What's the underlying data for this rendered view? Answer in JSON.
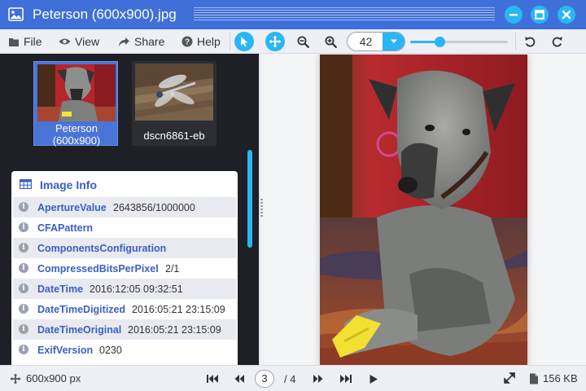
{
  "window": {
    "title": "Peterson (600x900).jpg"
  },
  "menu": {
    "file": "File",
    "view": "View",
    "share": "Share",
    "help": "Help"
  },
  "zoom": {
    "value": "42",
    "slider_level_percent": 30
  },
  "thumbnails": [
    {
      "label": "Peterson\n(600x900)",
      "selected": true
    },
    {
      "label": "dscn6861-eb",
      "selected": false
    }
  ],
  "info": {
    "title": "Image Info",
    "rows": [
      {
        "key": "ApertureValue",
        "value": "2643856/1000000"
      },
      {
        "key": "CFAPattern",
        "value": ""
      },
      {
        "key": "ComponentsConfiguration",
        "value": ""
      },
      {
        "key": "CompressedBitsPerPixel",
        "value": "2/1"
      },
      {
        "key": "DateTime",
        "value": "2016:12:05 09:32:51"
      },
      {
        "key": "DateTimeDigitized",
        "value": "2016:05:21 23:15:09"
      },
      {
        "key": "DateTimeOriginal",
        "value": "2016:05:21 23:15:09"
      },
      {
        "key": "ExifVersion",
        "value": "0230"
      }
    ]
  },
  "status": {
    "dimensions": "600x900 px",
    "current_page": "3",
    "total_pages": "/ 4",
    "file_size": "156 KB"
  },
  "colors": {
    "accent": "#29b6f6",
    "titlebar": "#3f6fd8",
    "link": "#3a5fc8"
  }
}
